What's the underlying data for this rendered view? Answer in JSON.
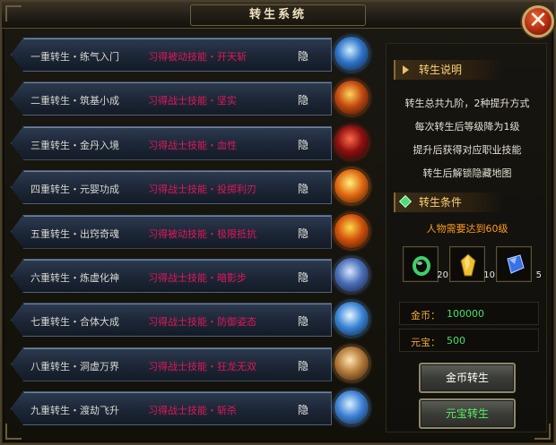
{
  "window": {
    "title": "转生系统",
    "close_label": "✕"
  },
  "rows": [
    {
      "name": "一重转生・练气入门",
      "skill": "习得被动技能・开天斩",
      "hide": "隐",
      "icon": "ice-shard-icon",
      "colors": [
        "#cfeeff",
        "#2f74c8",
        "#0a1a33"
      ]
    },
    {
      "name": "二重转生・筑基小成",
      "skill": "习得战士技能・坚实",
      "hide": "隐",
      "icon": "flame-warrior-icon",
      "colors": [
        "#ffd35a",
        "#c24a10",
        "#2a0c05"
      ]
    },
    {
      "name": "三重转生・金丹入境",
      "skill": "习得战士技能・血性",
      "hide": "隐",
      "icon": "demon-face-icon",
      "colors": [
        "#ff6a4a",
        "#8e1010",
        "#1c0303"
      ]
    },
    {
      "name": "四重转生・元婴功成",
      "skill": "习得战士技能・投掷利刃",
      "hide": "隐",
      "icon": "fire-blade-icon",
      "colors": [
        "#fff07a",
        "#e36a12",
        "#3a1405"
      ]
    },
    {
      "name": "五重转生・出窍奇魂",
      "skill": "习得被动技能・极限抵抗",
      "hide": "隐",
      "icon": "fire-shield-icon",
      "colors": [
        "#ffd84a",
        "#d2520c",
        "#341204"
      ]
    },
    {
      "name": "六重转生・炼虚化神",
      "skill": "习得战士技能・暗影步",
      "hide": "隐",
      "icon": "shadow-step-icon",
      "colors": [
        "#d6e6ff",
        "#4a6fb8",
        "#101a33"
      ]
    },
    {
      "name": "七重转生・合体大成",
      "skill": "习得战士技能・防御姿态",
      "hide": "隐",
      "icon": "defense-stance-icon",
      "colors": [
        "#e8f6ff",
        "#3a86d8",
        "#081a36"
      ]
    },
    {
      "name": "八重转生・洞虚万界",
      "skill": "习得战士技能・狂龙无双",
      "hide": "隐",
      "icon": "wind-dragon-icon",
      "colors": [
        "#ffe6b0",
        "#b47a3a",
        "#2a1608"
      ]
    },
    {
      "name": "九重转生・渡劫飞升",
      "skill": "习得战士技能・斩杀",
      "hide": "隐",
      "icon": "execute-slash-icon",
      "colors": [
        "#d8f0ff",
        "#3f82d6",
        "#0a1a36"
      ]
    }
  ],
  "info": {
    "title": "转生说明",
    "lines": [
      "转生总共九阶，2种提升方式",
      "每次转生后等级降为1级",
      "提升后获得对应职业技能",
      "转生后解锁隐藏地图"
    ]
  },
  "conditions": {
    "title": "转生条件",
    "requirement": "人物需要达到60级",
    "items": [
      {
        "count": "20",
        "icon": "jade-ring-icon",
        "color": "#3fcf6a"
      },
      {
        "count": "10",
        "icon": "gold-crystal-icon",
        "color": "#f0c030"
      },
      {
        "count": "5",
        "icon": "blue-gem-icon",
        "color": "#3a70e8"
      }
    ]
  },
  "currency": {
    "gold_label": "金币：",
    "gold_value": "100000",
    "yuanbao_label": "元宝：",
    "yuanbao_value": "500"
  },
  "buttons": {
    "gold_rebirth": "金币转生",
    "yuanbao_rebirth": "元宝转生"
  }
}
